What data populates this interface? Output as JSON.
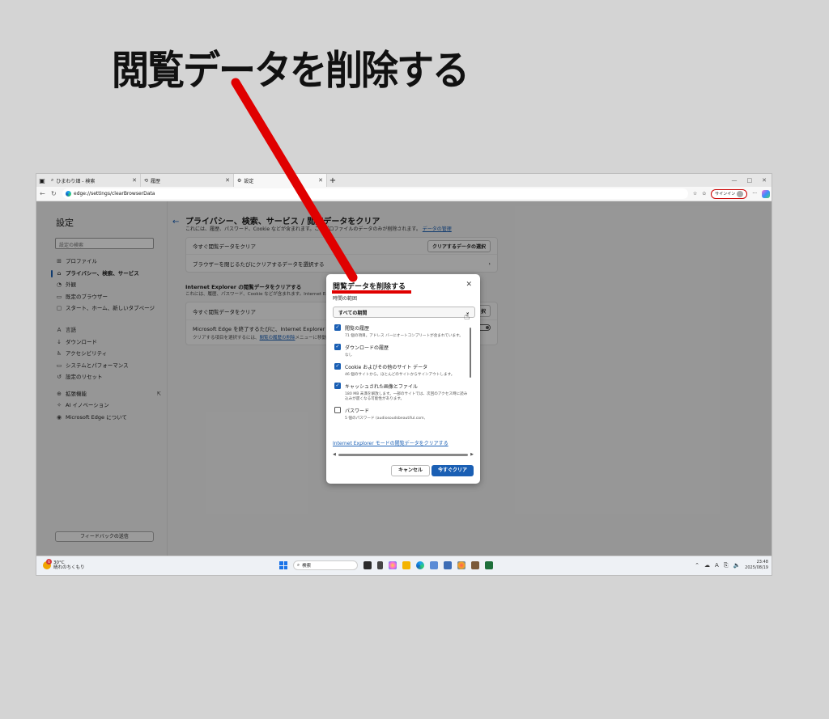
{
  "annotation": {
    "caption": "閲覧データを削除する",
    "arrow_color": "#e00000"
  },
  "tabs": [
    {
      "label": "ひまわり畑 - 検索",
      "icon": "search-icon"
    },
    {
      "label": "履歴",
      "icon": "history-icon"
    },
    {
      "label": "設定",
      "icon": "gear-icon"
    }
  ],
  "address": {
    "url": "edge://settings/clearBrowserData",
    "signin_label": "サインイン"
  },
  "sidebar": {
    "title": "設定",
    "search_placeholder": "設定の検索",
    "items": [
      {
        "label": "プロファイル",
        "icon": "profile-icon"
      },
      {
        "label": "プライバシー、検索、サービス",
        "icon": "lock-icon",
        "active": true
      },
      {
        "label": "外観",
        "icon": "appearance-icon"
      },
      {
        "label": "既定のブラウザー",
        "icon": "browser-icon"
      },
      {
        "label": "スタート、ホーム、新しいタブページ",
        "icon": "home-icon"
      },
      {
        "label": "言語",
        "icon": "language-icon"
      },
      {
        "label": "ダウンロード",
        "icon": "download-icon"
      },
      {
        "label": "アクセシビリティ",
        "icon": "accessibility-icon"
      },
      {
        "label": "システムとパフォーマンス",
        "icon": "system-icon"
      },
      {
        "label": "設定のリセット",
        "icon": "reset-icon"
      },
      {
        "label": "拡張機能",
        "icon": "extensions-icon"
      },
      {
        "label": "AI イノベーション",
        "icon": "ai-icon"
      },
      {
        "label": "Microsoft Edge について",
        "icon": "edge-icon"
      }
    ],
    "feedback_label": "フィードバックの送信"
  },
  "main": {
    "heading": "プライバシー、検索、サービス / 閲覧データをクリア",
    "subheading_start": "これには、履歴、パスワード、Cookie などが含まれます。このプロファイルのデータのみが削除されます。",
    "subheading_link": "データの管理",
    "card1": {
      "row1_label": "今すぐ閲覧データをクリア",
      "row1_button": "クリアするデータの選択",
      "row2_label": "ブラウザーを閉じるたびにクリアするデータを選択する"
    },
    "ie_section_title": "Internet Explorer の閲覧データをクリアする",
    "ie_section_sub": "これには、履歴、パスワード、Cookie などが含まれます。Internet Explorer",
    "card2": {
      "row1_label": "今すぐ閲覧データをクリア",
      "row1_button": "択",
      "row2_label": "Microsoft Edge を終了するたびに、Internet Explorer や Internet",
      "row2_sub_start": "クリアする項目を選択するには、",
      "row2_sub_link": "閲覧の履歴の削除",
      "row2_sub_end": "メニューに移動"
    }
  },
  "dialog": {
    "title": "閲覧データを削除する",
    "range_label": "時間の範囲",
    "range_value": "すべての期間",
    "options": [
      {
        "label": "閲覧の履歴",
        "desc": "71 個の項目。アドレス バーにオートコンプリートが含まれています。",
        "checked": true
      },
      {
        "label": "ダウンロードの履歴",
        "desc": "なし",
        "checked": true
      },
      {
        "label": "Cookie およびその他のサイト データ",
        "desc": "46 個のサイトから。ほとんどのサイトからサインアウトします。",
        "checked": true
      },
      {
        "label": "キャッシュされた画像とファイル",
        "desc": "180 MB 未満を解放します。一部のサイトでは、次回のアクセス時に読み込みが遅くなる可能性があります。",
        "checked": true
      },
      {
        "label": "パスワード",
        "desc": "5 個のパスワード (audiosoudsbeautiful.com,",
        "checked": false
      }
    ],
    "ie_link": "Internet Explorer モードの閲覧データをクリアする",
    "cancel_label": "キャンセル",
    "clear_label": "今すぐクリア"
  },
  "taskbar": {
    "weather_temp": "30°C",
    "weather_desc": "晴れのちくもり",
    "weather_badge": "6",
    "search_placeholder": "検索",
    "time": "23:48",
    "date": "2025/08/19",
    "ime": "A"
  }
}
